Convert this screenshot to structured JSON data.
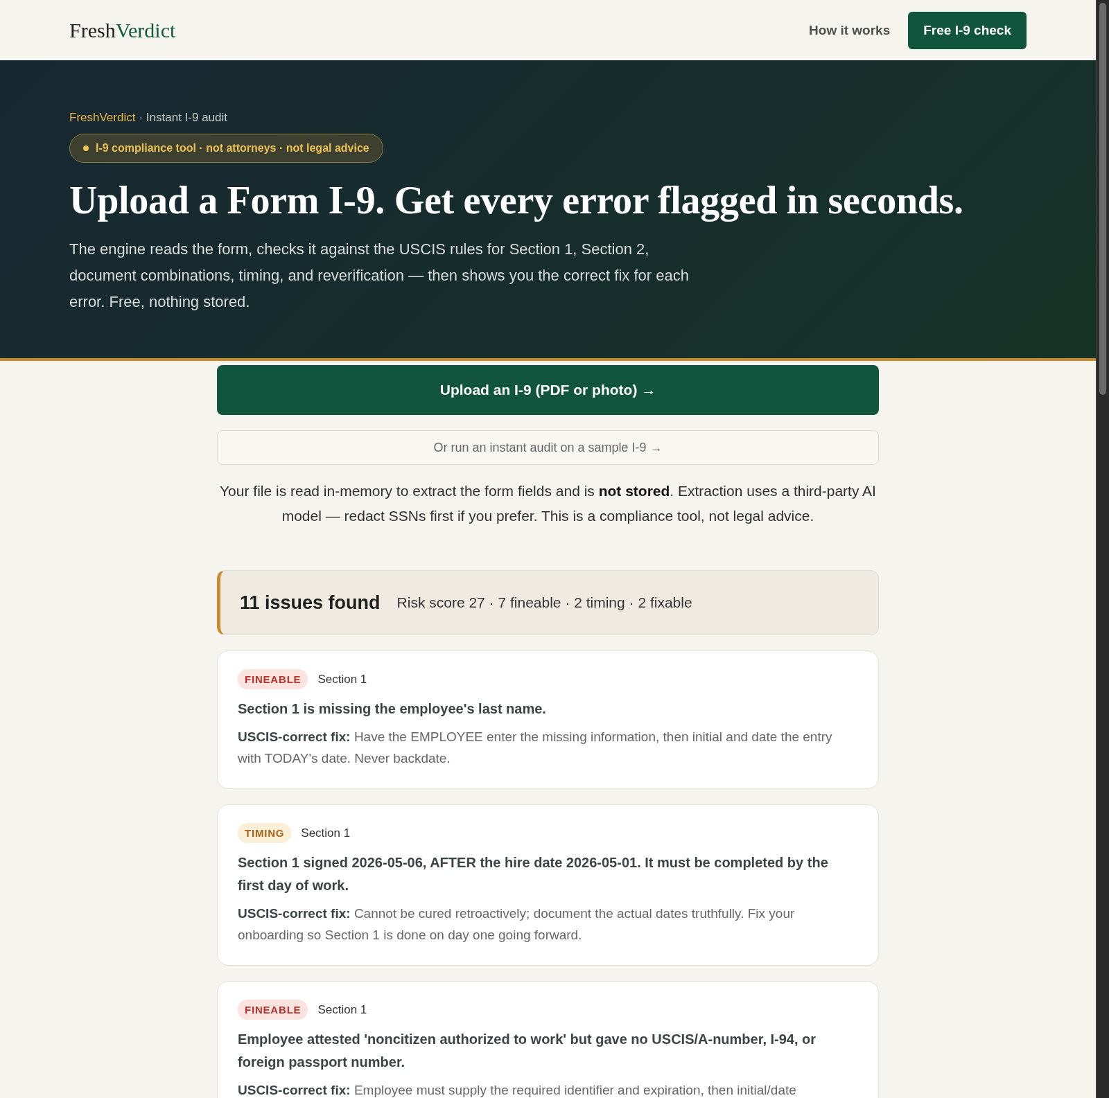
{
  "header": {
    "logo": {
      "first": "Fresh",
      "second": "Verdict"
    },
    "nav_link": "How it works",
    "cta_button": "Free I-9 check"
  },
  "hero": {
    "breadcrumb": {
      "brand": "FreshVerdict",
      "rest": "· Instant I-9 audit"
    },
    "pill": "I-9 compliance tool · not attorneys · not legal advice",
    "headline": "Upload a Form I-9. Get every error flagged in seconds.",
    "intro": "The engine reads the form, checks it against the USCIS rules for Section 1, Section 2, document combinations, timing, and reverification — then shows you the correct fix for each error. Free, nothing stored."
  },
  "upload": {
    "primary_button": "Upload an I-9 (PDF or photo) →",
    "sample_button": "Or run an instant audit on a sample I-9 →",
    "privacy_note": "Your file is read in-memory to extract the form fields and is **not stored**. Extraction uses a third-party AI model — redact SSNs first if you prefer. This is a compliance tool, not legal advice."
  },
  "summary": {
    "title": "11 issues found",
    "details": "Risk score 27 · 7 fineable · 2 timing · 2 fixable"
  },
  "issues": [
    {
      "kind": "fineable",
      "tag": "FINEABLE",
      "section": "Section 1",
      "problem": "Section 1 is missing the employee's last name.",
      "fix": "**USCIS-correct fix:** Have the EMPLOYEE enter the missing information, then initial and date the entry with TODAY's date. Never backdate."
    },
    {
      "kind": "timing",
      "tag": "TIMING",
      "section": "Section 1",
      "problem": "Section 1 signed 2026-05-06, AFTER the hire date 2026-05-01. It must be completed by the first day of work.",
      "fix": "**USCIS-correct fix:** Cannot be cured retroactively; document the actual dates truthfully. Fix your onboarding so Section 1 is done on day one going forward."
    },
    {
      "kind": "fineable",
      "tag": "FINEABLE",
      "section": "Section 1",
      "problem": "Employee attested 'noncitizen authorized to work' but gave no USCIS/A-number, I-94, or foreign passport number.",
      "fix": "**USCIS-correct fix:** Employee must supply the required identifier and expiration, then initial/date"
    }
  ]
}
